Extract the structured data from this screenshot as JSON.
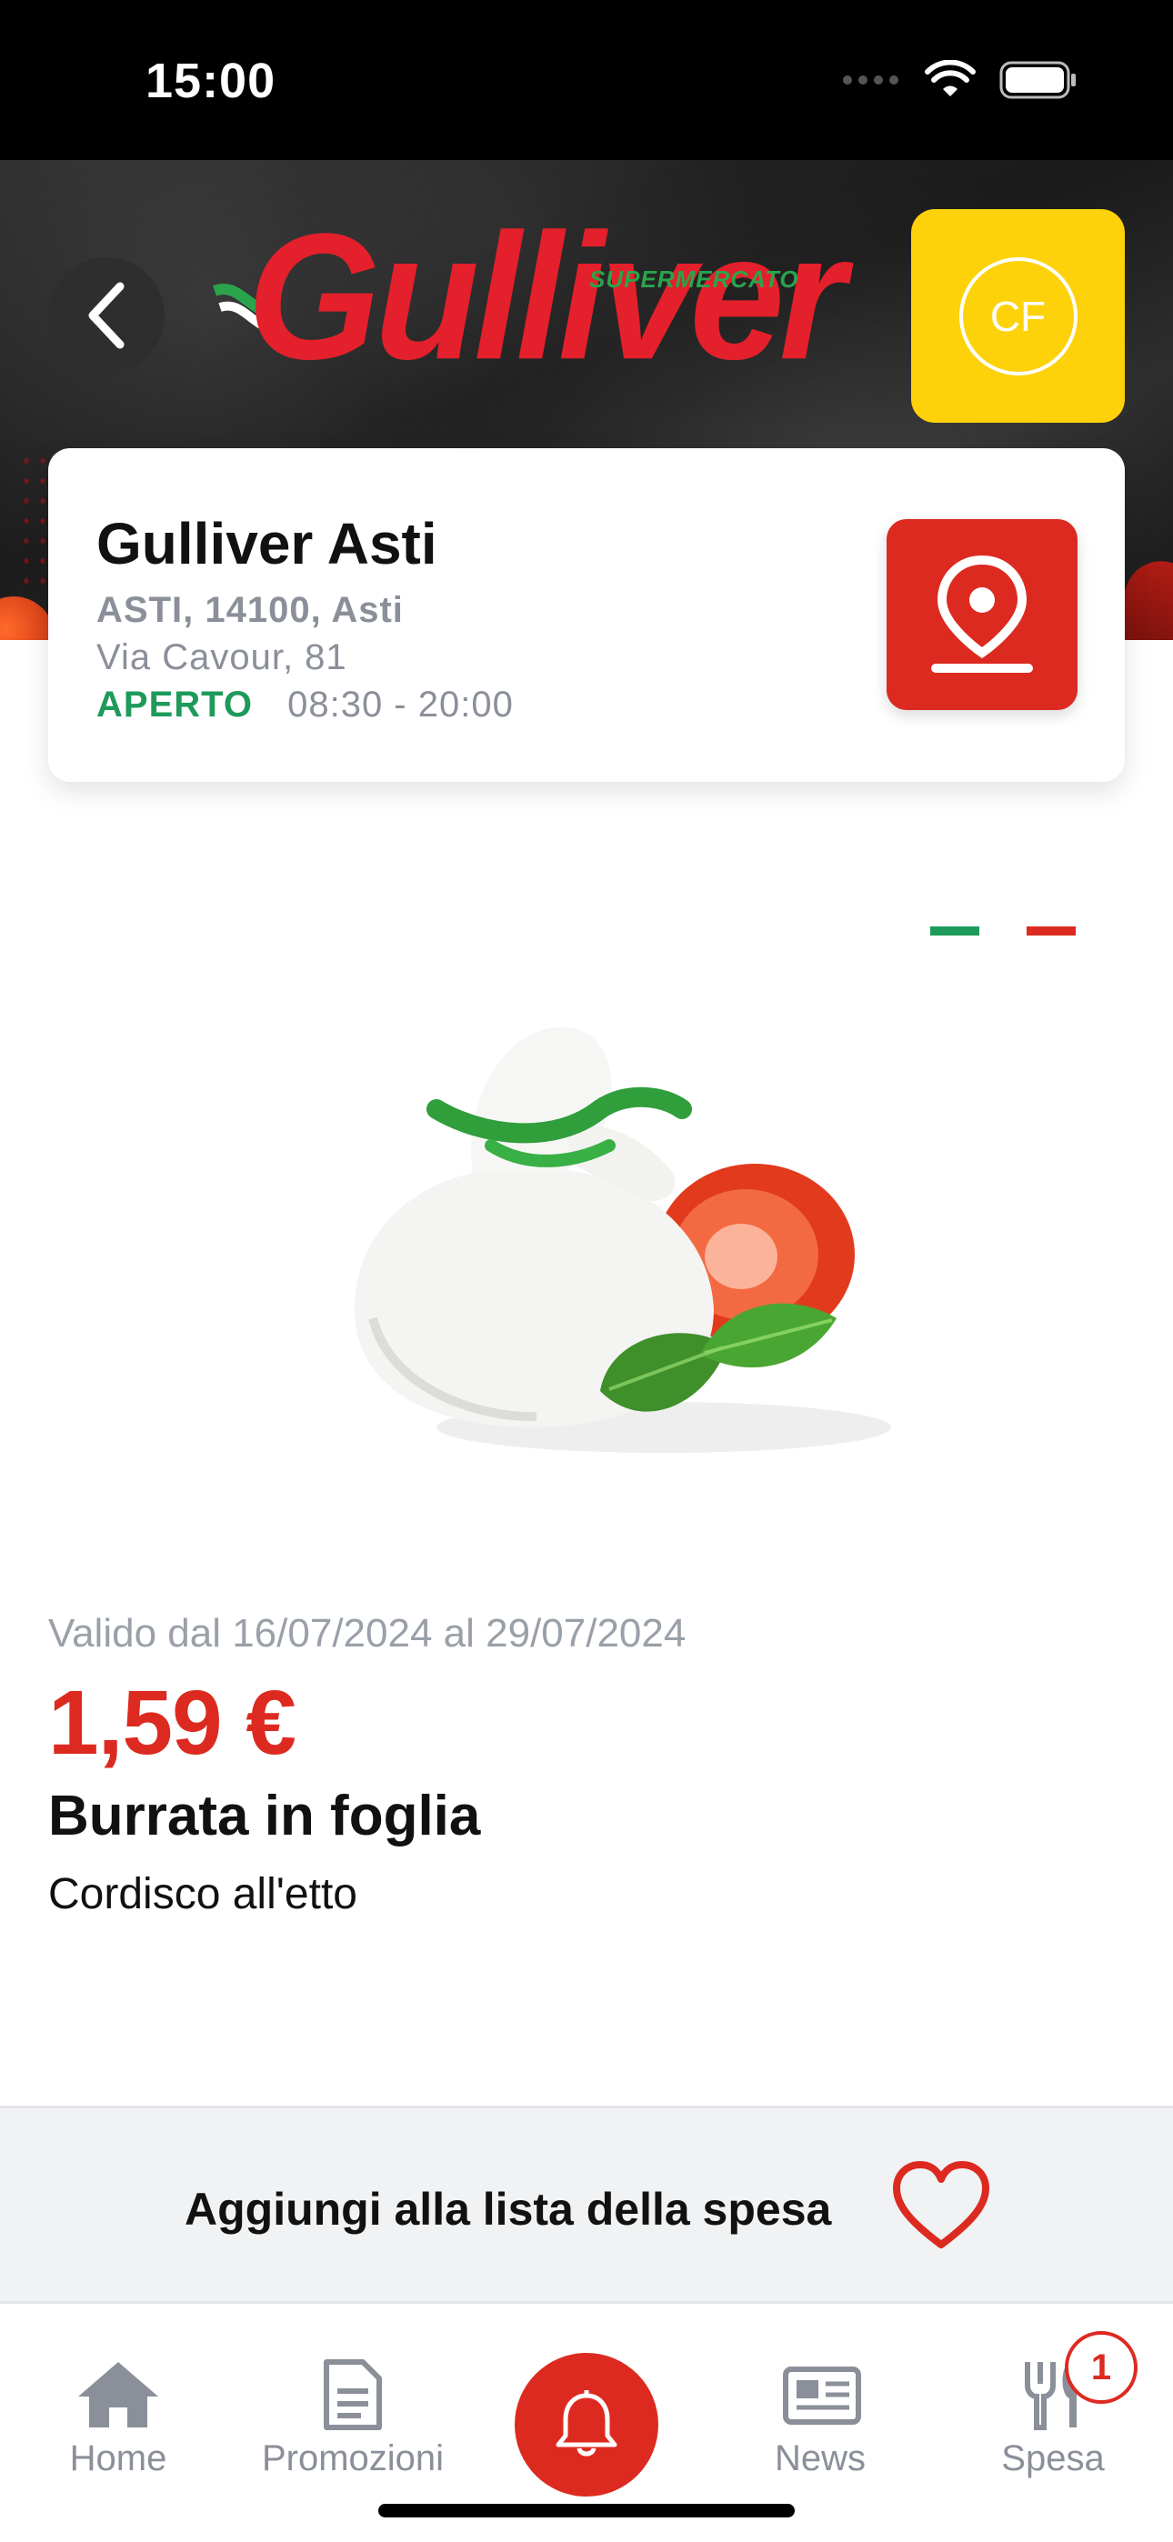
{
  "status_bar": {
    "time": "15:00"
  },
  "header": {
    "brand_name": "Gulliver",
    "brand_sub": "SUPERMERCATO",
    "avatar_initials": "CF"
  },
  "store": {
    "name": "Gulliver Asti",
    "city_line": "ASTI, 14100, Asti",
    "street": "Via Cavour, 81",
    "status": "APERTO",
    "hours": "08:30 - 20:00"
  },
  "carousel": {
    "dots": [
      {
        "color": "#1e9a5a",
        "active": true
      },
      {
        "color": "#dd2a20",
        "active": false
      }
    ]
  },
  "product": {
    "validity": "Valido dal 16/07/2024 al 29/07/2024",
    "price": "1,59 €",
    "name": "Burrata in foglia",
    "description": "Cordisco all'etto"
  },
  "add_to_list": {
    "label": "Aggiungi alla lista della spesa"
  },
  "tabs": [
    {
      "label": "Home",
      "icon": "home-icon"
    },
    {
      "label": "Promozioni",
      "icon": "document-icon"
    },
    {
      "label": "",
      "icon": "bell-icon"
    },
    {
      "label": "News",
      "icon": "newspaper-icon"
    },
    {
      "label": "Spesa",
      "icon": "fork-knife-icon"
    }
  ],
  "cart_badge": "1",
  "colors": {
    "brand_red": "#dd2a20",
    "brand_yellow": "#fdd20a",
    "open_green": "#1e9a5a"
  }
}
